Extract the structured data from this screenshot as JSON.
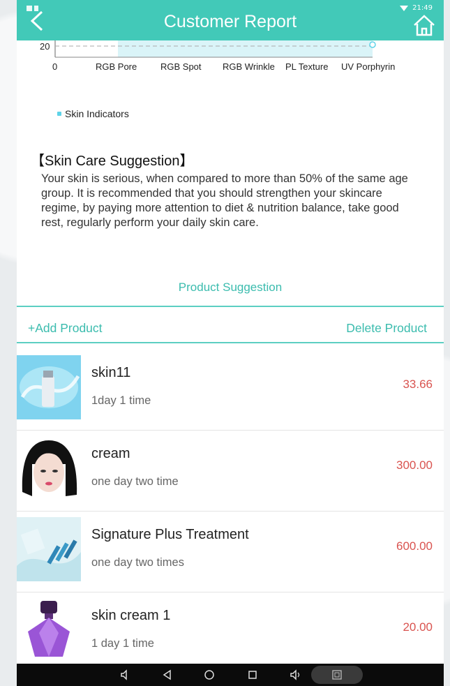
{
  "header": {
    "title": "Customer Report",
    "time": "21:49"
  },
  "chart_data": {
    "type": "line",
    "categories": [
      "RGB Pore",
      "RGB Spot",
      "RGB Wrinkle",
      "PL Texture",
      "UV Porphyrin"
    ],
    "origin_label": "0",
    "y_tick": "20",
    "series": [
      {
        "name": "Skin Indicators",
        "values": [
          20,
          20,
          20,
          20,
          20
        ]
      }
    ]
  },
  "suggestion": {
    "title": "【Skin Care Suggestion】",
    "body": "Your skin is serious, when compared to more than 50% of the same age group. It is recommended that you should strengthen your skincare regime, by paying more attention to diet & nutrition balance, take good rest, regularly perform your daily skin care."
  },
  "product_section": {
    "title": "Product Suggestion",
    "add_label": "+Add Product",
    "delete_label": "Delete Product"
  },
  "products": [
    {
      "name": "skin11",
      "frequency": "1day 1 time",
      "price": "33.66"
    },
    {
      "name": "cream",
      "frequency": "one day two time",
      "price": "300.00"
    },
    {
      "name": "Signature Plus Treatment",
      "frequency": "one day two times",
      "price": "600.00"
    },
    {
      "name": "skin cream 1",
      "frequency": "1 day 1 time",
      "price": "20.00"
    }
  ],
  "colors": {
    "accent": "#42c9b8",
    "price": "#d9534f",
    "series": "#5fd3e8"
  }
}
